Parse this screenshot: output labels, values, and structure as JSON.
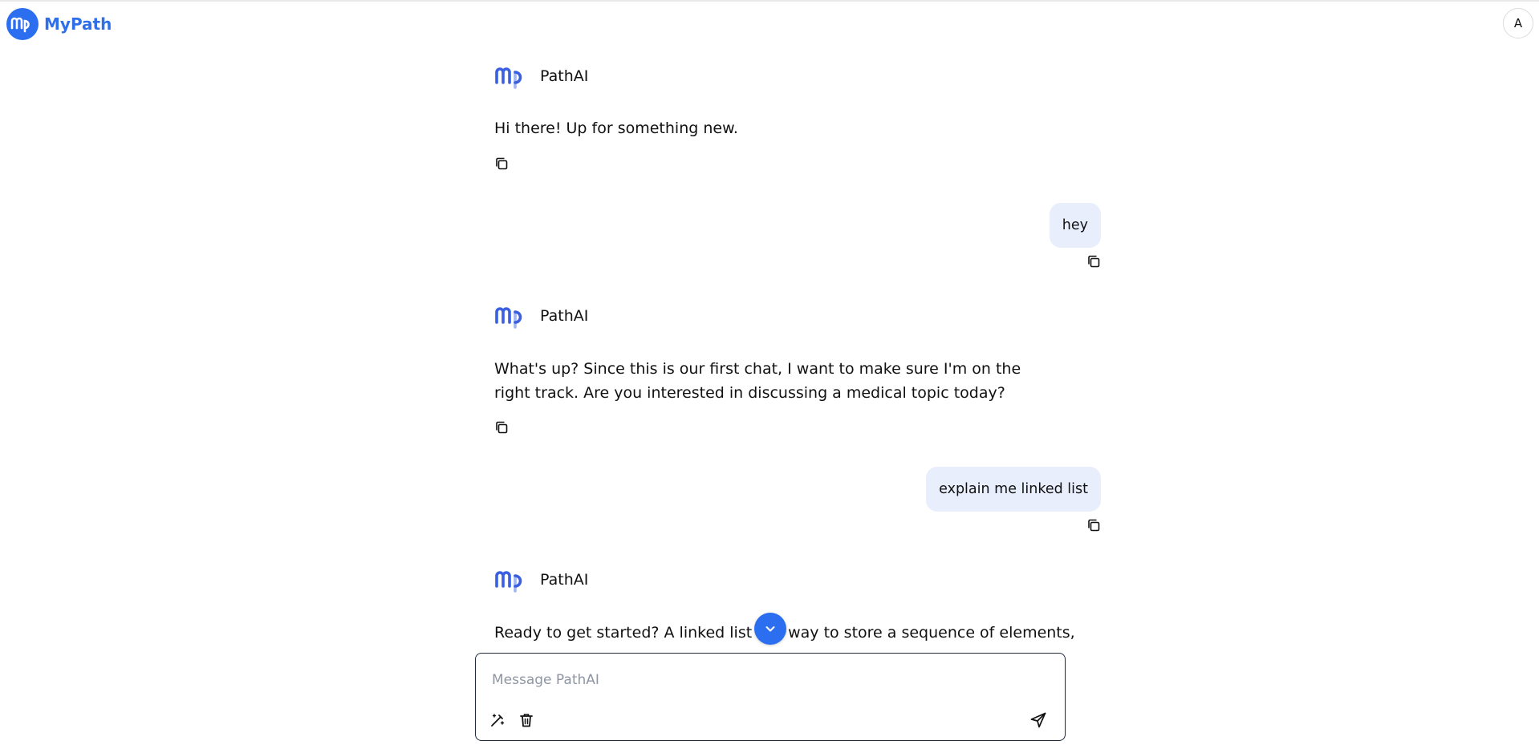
{
  "header": {
    "brand_logo_text": "mp",
    "brand_name": "MyPath",
    "avatar_initial": "A"
  },
  "conversation": {
    "assistant_name": "PathAI",
    "messages": [
      {
        "role": "assistant",
        "text": "Hi there! Up for something new."
      },
      {
        "role": "user",
        "text": "hey"
      },
      {
        "role": "assistant",
        "text": "What's up? Since this is our first chat, I want to make sure I'm on the right track. Are you interested in discussing a medical topic today?"
      },
      {
        "role": "user",
        "text": "explain me linked list"
      },
      {
        "role": "assistant",
        "text": "Ready to get started? A linked list is a way to store a sequence of elements,"
      }
    ]
  },
  "composer": {
    "placeholder": "Message PathAI",
    "value": ""
  },
  "icons": {
    "copy": "copy-icon",
    "scroll_down": "chevron-down-icon",
    "magic": "magic-wand-icon",
    "delete": "trash-icon",
    "send": "send-icon"
  },
  "colors": {
    "brand": "#2f6fe8",
    "accent": "#2b6ff0",
    "user_bubble": "#e8eefc"
  }
}
